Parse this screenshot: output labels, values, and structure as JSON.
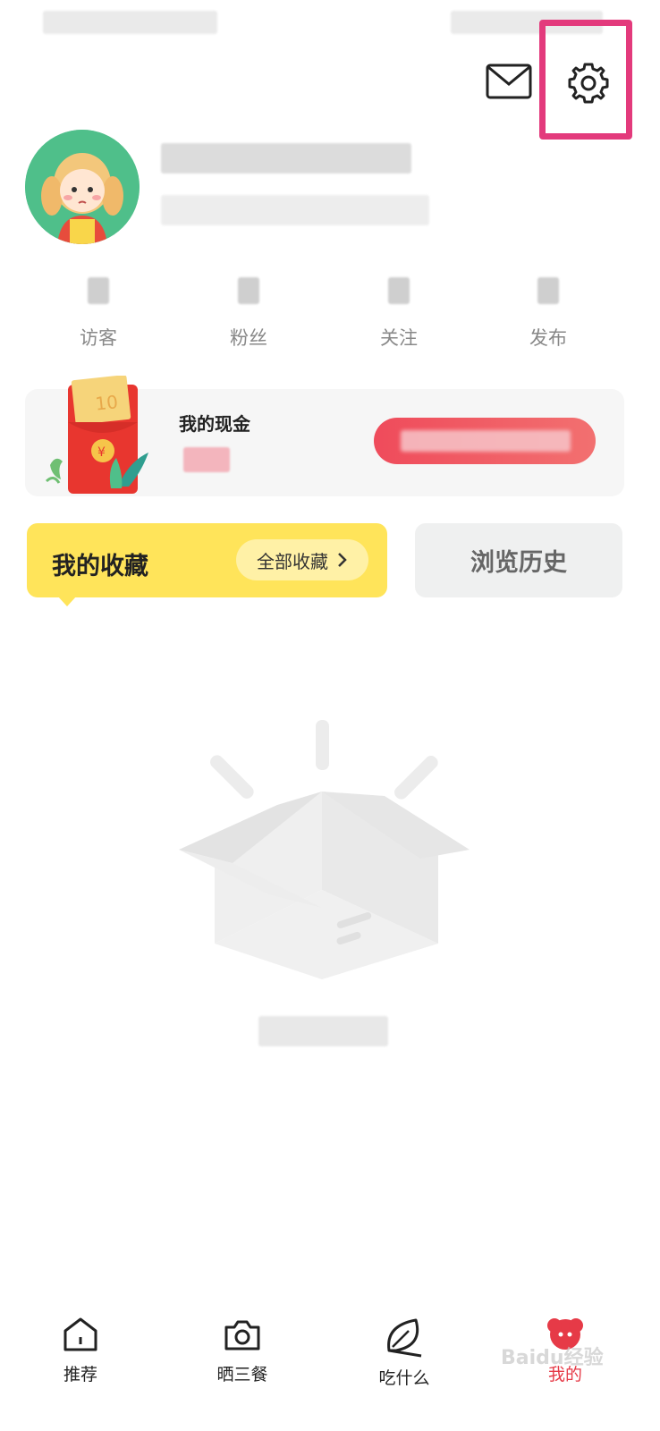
{
  "header": {
    "mail_icon": "mail-icon",
    "settings_icon": "gear-icon",
    "highlight_color": "#e33a7c"
  },
  "stats": [
    {
      "label": "访客"
    },
    {
      "label": "粉丝"
    },
    {
      "label": "关注"
    },
    {
      "label": "发布"
    }
  ],
  "cash": {
    "title": "我的现金"
  },
  "tabs": {
    "favorites_title": "我的收藏",
    "all_favorites_label": "全部收藏",
    "history_label": "浏览历史",
    "favorites_color": "#ffe45a"
  },
  "bottom_nav": [
    {
      "label": "推荐",
      "icon": "home-icon"
    },
    {
      "label": "晒三餐",
      "icon": "camera-icon"
    },
    {
      "label": "吃什么",
      "icon": "leaf-icon"
    },
    {
      "label": "我的",
      "icon": "profile-icon",
      "active": true
    }
  ],
  "watermark": "Baidu经验",
  "accent_color": "#e63a47"
}
